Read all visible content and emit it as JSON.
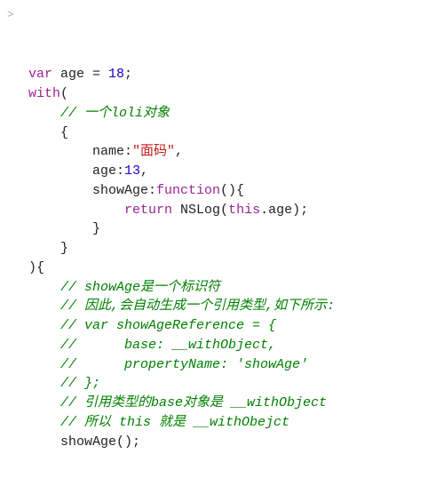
{
  "gutter": ">",
  "code": {
    "l1_var": "var",
    "l1_age": " age = ",
    "l1_num": "18",
    "l1_semi": ";",
    "l2_with": "with",
    "l2_paren": "(",
    "l3_com": "// 一个loli对象",
    "l4_brace": "{",
    "l5_name": "name:",
    "l5_str": "\"面码\"",
    "l5_comma": ",",
    "l6_age": "age:",
    "l6_num": "13",
    "l6_comma": ",",
    "l7_show": "showAge:",
    "l7_fn": "function",
    "l7_paren": "(){",
    "l8_ret": "return",
    "l8_ns": " NSLog(",
    "l8_this": "this",
    "l8_dot": ".age);",
    "l9_brace": "}",
    "l10_brace": "}",
    "l11_close": "){",
    "l12_com": "// showAge是一个标识符",
    "l13_com": "// 因此,会自动生成一个引用类型,如下所示:",
    "l14_com": "// var showAgeReference = {",
    "l15_com": "//      base: __withObject,",
    "l16_com": "//      propertyName: 'showAge'",
    "l17_com": "// };",
    "l18_com": "// 引用类型的base对象是 __withObject",
    "l19_com": "// 所以 this 就是 __withObejct",
    "l20_call": "showAge();"
  }
}
